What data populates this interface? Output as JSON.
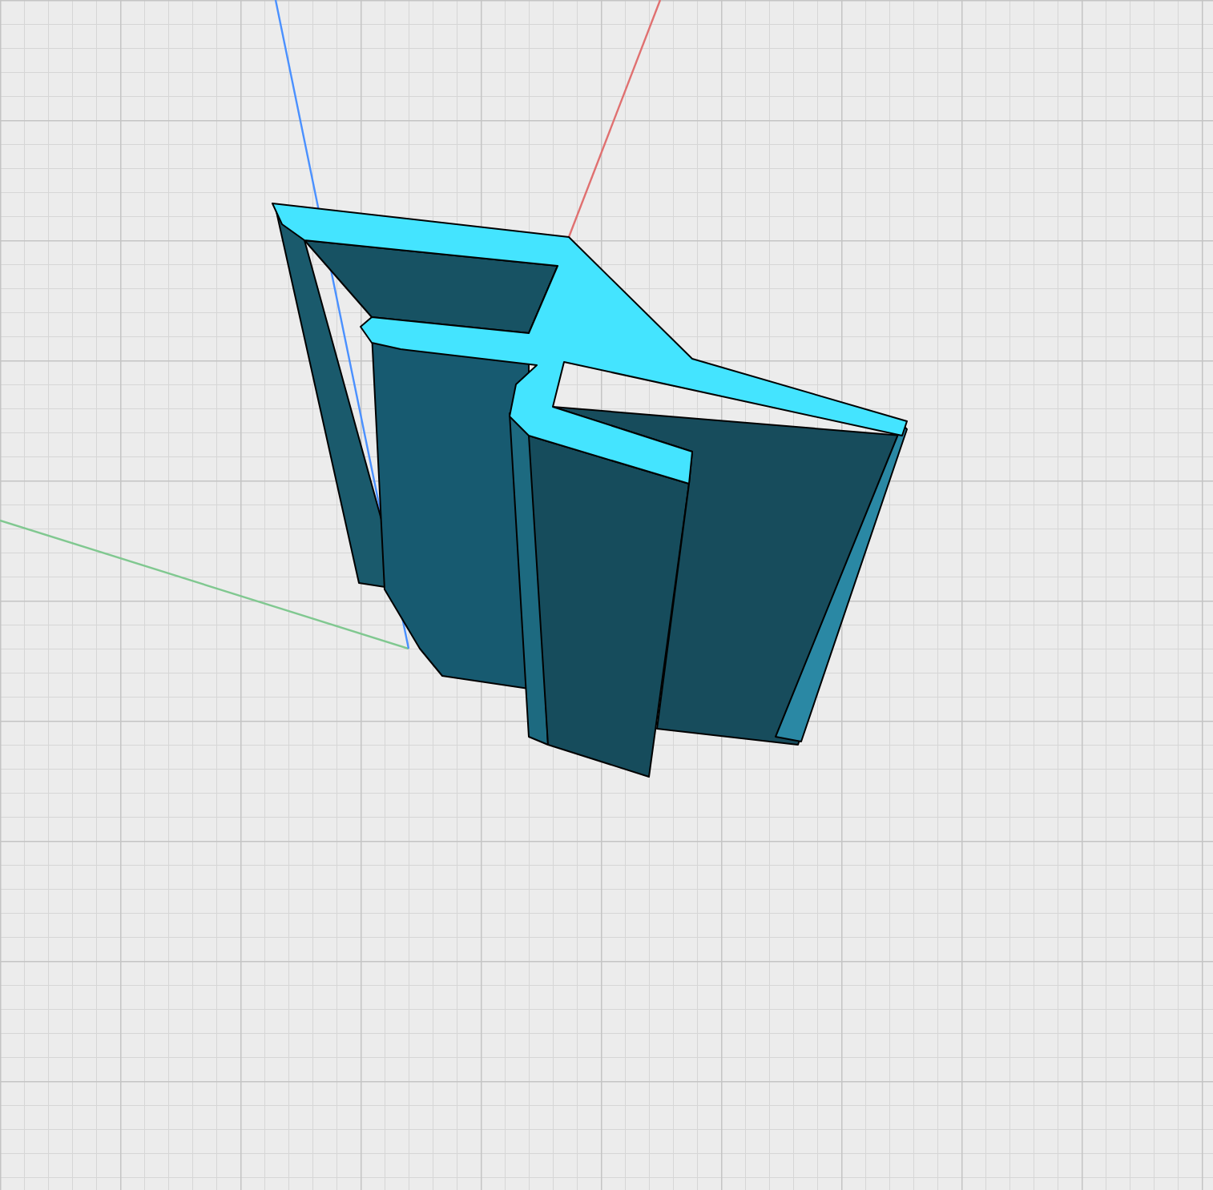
{
  "axes": [
    {
      "color": "#e07070"
    },
    {
      "color": "#80c890"
    },
    {
      "color": "#4a90ff"
    }
  ]
}
